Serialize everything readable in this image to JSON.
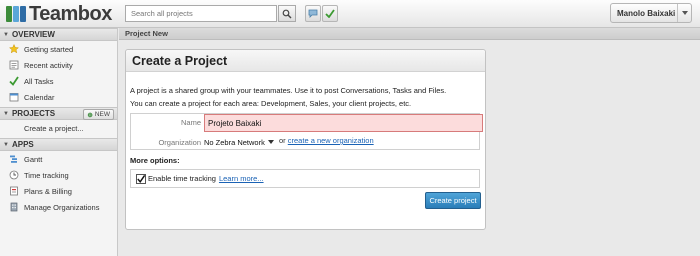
{
  "app": {
    "logo_text": "Teambox"
  },
  "search": {
    "placeholder": "Search all projects",
    "value": ""
  },
  "user": {
    "name": "Manolo Baixaki"
  },
  "sidebar": {
    "overview": {
      "title": "OVERVIEW",
      "items": [
        {
          "label": "Getting started",
          "icon": "star-icon"
        },
        {
          "label": "Recent activity",
          "icon": "activity-icon"
        },
        {
          "label": "All Tasks",
          "icon": "checkmark-icon"
        },
        {
          "label": "Calendar",
          "icon": "calendar-icon"
        }
      ]
    },
    "projects": {
      "title": "PROJECTS",
      "new_label": "NEW",
      "items": [
        {
          "label": "Create a project..."
        }
      ]
    },
    "apps": {
      "title": "APPS",
      "items": [
        {
          "label": "Gantt",
          "icon": "gantt-icon"
        },
        {
          "label": "Time tracking",
          "icon": "clock-icon"
        },
        {
          "label": "Plans & Billing",
          "icon": "billing-icon"
        },
        {
          "label": "Manage Organizations",
          "icon": "building-icon"
        }
      ]
    }
  },
  "breadcrumb": "Project New",
  "form": {
    "title": "Create a Project",
    "intro_line1": "A project is a shared group with your teammates. Use it to post Conversations, Tasks and Files.",
    "intro_line2": "You can create a project for each area: Development, Sales, your client projects, etc.",
    "name_label": "Name",
    "name_value": "Projeto Baixaki",
    "org_label": "Organization",
    "org_selected": "No Zebra Network",
    "org_or": "or",
    "org_create_link": "create a new organization",
    "more_options_label": "More options:",
    "time_tracking_label": "Enable time tracking",
    "time_tracking_checked": true,
    "learn_more": "Learn more...",
    "submit_label": "Create project"
  },
  "colors": {
    "accent": "#2a7db8",
    "error_bg": "#fcdcdc",
    "link": "#1a62b5"
  }
}
